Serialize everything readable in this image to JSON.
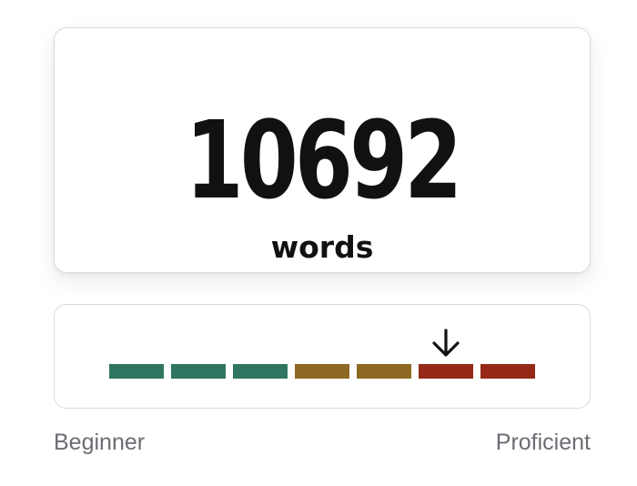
{
  "word_count": {
    "value": "10692",
    "unit": "words"
  },
  "level_indicator": {
    "segments": [
      {
        "color": "#2f7562"
      },
      {
        "color": "#2f7562"
      },
      {
        "color": "#2f7562"
      },
      {
        "color": "#8d6823"
      },
      {
        "color": "#8d6823"
      },
      {
        "color": "#962818"
      },
      {
        "color": "#962818"
      }
    ],
    "current_segment": 6,
    "arrow_icon": "arrow-down-icon",
    "min_label": "Beginner",
    "max_label": "Proficient"
  }
}
